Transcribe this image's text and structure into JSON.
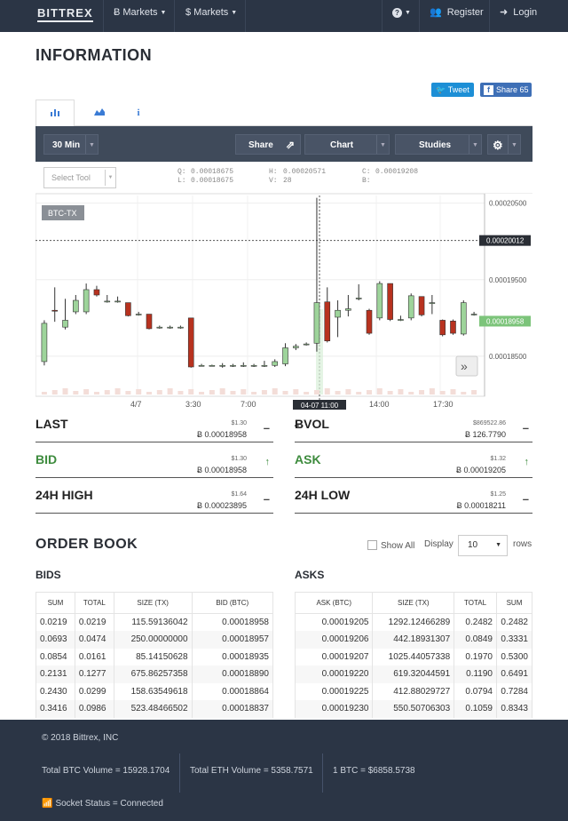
{
  "nav": {
    "brand": "BITTREX",
    "btc_markets": "Ƀ Markets",
    "usd_markets": "$ Markets",
    "help": "?",
    "register": "Register",
    "login": "Login"
  },
  "page_title": "INFORMATION",
  "social": {
    "tweet": "Tweet",
    "share": "Share",
    "share_count": "65"
  },
  "toolbar": {
    "interval": "30 Min",
    "share": "Share",
    "chart": "Chart",
    "studies": "Studies"
  },
  "quote": {
    "select_tool": "Select Tool",
    "o_label": "Q:",
    "o_value": "0.00018675",
    "l_label": "L:",
    "l_value": "0.00018675",
    "h_label": "H:",
    "h_value": "0.00020571",
    "v_label": "V:",
    "v_value": "28",
    "c_label": "C:",
    "c_value": "0.00019208",
    "b_label": "B:"
  },
  "chart_data": {
    "type": "candlestick",
    "symbol": "BTC-TX",
    "x_tick_labels": [
      "4/7",
      "3:30",
      "7:00",
      "04-07 11:00",
      "14:00",
      "17:30"
    ],
    "y_tick_labels": [
      "0.00020500",
      "0.00019500",
      "0.00018500"
    ],
    "ylim": [
      0.00018,
      0.000206
    ],
    "crosshair_price": "0.00020012",
    "last_price": "0.00018958",
    "candles": [
      {
        "o": 0.0001843,
        "c": 0.0001893,
        "h": 0.0001897,
        "l": 0.0001838
      },
      {
        "o": 0.000191,
        "c": 0.0001909,
        "h": 0.000194,
        "l": 0.0001895
      },
      {
        "o": 0.0001888,
        "c": 0.0001897,
        "h": 0.0001925,
        "l": 0.0001885
      },
      {
        "o": 0.0001908,
        "c": 0.0001923,
        "h": 0.000193,
        "l": 0.0001905
      },
      {
        "o": 0.0001908,
        "c": 0.0001937,
        "h": 0.0001945,
        "l": 0.0001905
      },
      {
        "o": 0.0001937,
        "c": 0.000193,
        "h": 0.0001942,
        "l": 0.0001928
      },
      {
        "o": 0.0001922,
        "c": 0.0001922,
        "h": 0.000193,
        "l": 0.000192
      },
      {
        "o": 0.0001922,
        "c": 0.0001922,
        "h": 0.0001928,
        "l": 0.000192
      },
      {
        "o": 0.000192,
        "c": 0.0001903,
        "h": 0.000192,
        "l": 0.0001902
      },
      {
        "o": 0.0001905,
        "c": 0.0001905,
        "h": 0.0001908,
        "l": 0.0001903
      },
      {
        "o": 0.0001905,
        "c": 0.0001886,
        "h": 0.0001905,
        "l": 0.0001885
      },
      {
        "o": 0.0001888,
        "c": 0.0001888,
        "h": 0.000189,
        "l": 0.0001886
      },
      {
        "o": 0.0001888,
        "c": 0.0001888,
        "h": 0.000189,
        "l": 0.0001886
      },
      {
        "o": 0.0001888,
        "c": 0.0001888,
        "h": 0.000189,
        "l": 0.0001886
      },
      {
        "o": 0.00019,
        "c": 0.0001836,
        "h": 0.00019,
        "l": 0.0001835
      },
      {
        "o": 0.0001838,
        "c": 0.0001838,
        "h": 0.000184,
        "l": 0.0001837
      },
      {
        "o": 0.0001838,
        "c": 0.0001838,
        "h": 0.0001839,
        "l": 0.0001837
      },
      {
        "o": 0.0001838,
        "c": 0.0001838,
        "h": 0.0001841,
        "l": 0.0001835
      },
      {
        "o": 0.0001837,
        "c": 0.0001838,
        "h": 0.000184,
        "l": 0.0001836
      },
      {
        "o": 0.0001838,
        "c": 0.0001838,
        "h": 0.0001842,
        "l": 0.0001836
      },
      {
        "o": 0.0001838,
        "c": 0.0001838,
        "h": 0.000184,
        "l": 0.0001836
      },
      {
        "o": 0.0001838,
        "c": 0.0001838,
        "h": 0.0001844,
        "l": 0.0001836
      },
      {
        "o": 0.0001838,
        "c": 0.0001843,
        "h": 0.0001846,
        "l": 0.0001836
      },
      {
        "o": 0.000184,
        "c": 0.0001861,
        "h": 0.0001867,
        "l": 0.0001837
      },
      {
        "o": 0.0001861,
        "c": 0.0001863,
        "h": 0.0001866,
        "l": 0.0001858
      },
      {
        "o": 0.0001865,
        "c": 0.0001866,
        "h": 0.0001868,
        "l": 0.0001864
      },
      {
        "o": 0.0001867,
        "c": 0.000192,
        "h": 0.0002057,
        "l": 0.0001856
      },
      {
        "o": 0.0001921,
        "c": 0.000187,
        "h": 0.000194,
        "l": 0.0001868
      },
      {
        "o": 0.0001901,
        "c": 0.000191,
        "h": 0.0001923,
        "l": 0.0001875
      },
      {
        "o": 0.000191,
        "c": 0.0001912,
        "h": 0.000193,
        "l": 0.0001902
      },
      {
        "o": 0.0001925,
        "c": 0.0001926,
        "h": 0.0001944,
        "l": 0.0001923
      },
      {
        "o": 0.000191,
        "c": 0.000188,
        "h": 0.0001912,
        "l": 0.0001878
      },
      {
        "o": 0.00019,
        "c": 0.0001945,
        "h": 0.0001948,
        "l": 0.0001897
      },
      {
        "o": 0.0001945,
        "c": 0.0001898,
        "h": 0.0001945,
        "l": 0.0001896
      },
      {
        "o": 0.0001898,
        "c": 0.0001898,
        "h": 0.0001903,
        "l": 0.0001896
      },
      {
        "o": 0.00019,
        "c": 0.0001929,
        "h": 0.0001932,
        "l": 0.0001897
      },
      {
        "o": 0.0001928,
        "c": 0.0001904,
        "h": 0.0001928,
        "l": 0.0001902
      },
      {
        "o": 0.000192,
        "c": 0.000192,
        "h": 0.000193,
        "l": 0.0001905
      },
      {
        "o": 0.0001897,
        "c": 0.0001878,
        "h": 0.0001898,
        "l": 0.0001876
      },
      {
        "o": 0.0001896,
        "c": 0.000188,
        "h": 0.0001898,
        "l": 0.0001878
      },
      {
        "o": 0.0001879,
        "c": 0.000192,
        "h": 0.0001923,
        "l": 0.0001877
      },
      {
        "o": 0.0001905,
        "c": 0.0001905,
        "h": 0.0001908,
        "l": 0.0001903
      }
    ]
  },
  "stats": {
    "last": {
      "label": "LAST",
      "usd": "$1.30",
      "btc": "Ƀ 0.00018958",
      "icon": "–"
    },
    "bvol": {
      "label": "ɃVOL",
      "usd": "$869522.86",
      "btc": "Ƀ 126.7790",
      "icon": "–"
    },
    "bid": {
      "label": "BID",
      "usd": "$1.30",
      "btc": "Ƀ 0.00018958",
      "icon": "↑"
    },
    "ask": {
      "label": "ASK",
      "usd": "$1.32",
      "btc": "Ƀ 0.00019205",
      "icon": "↑"
    },
    "high": {
      "label": "24H HIGH",
      "usd": "$1.64",
      "btc": "Ƀ 0.00023895",
      "icon": "–"
    },
    "low": {
      "label": "24H LOW",
      "usd": "$1.25",
      "btc": "Ƀ 0.00018211",
      "icon": "–"
    }
  },
  "orderbook": {
    "title": "ORDER BOOK",
    "show_all": "Show All",
    "display": "Display",
    "display_value": "10",
    "rows_label": "rows",
    "bids_title": "BIDS",
    "asks_title": "ASKS",
    "bid_headers": [
      "SUM",
      "TOTAL",
      "SIZE (TX)",
      "BID (BTC)"
    ],
    "ask_headers": [
      "ASK (BTC)",
      "SIZE (TX)",
      "TOTAL",
      "SUM"
    ],
    "bids": [
      [
        "0.0219",
        "0.0219",
        "115.59136042",
        "0.00018958"
      ],
      [
        "0.0693",
        "0.0474",
        "250.00000000",
        "0.00018957"
      ],
      [
        "0.0854",
        "0.0161",
        "85.14150628",
        "0.00018935"
      ],
      [
        "0.2131",
        "0.1277",
        "675.86257358",
        "0.00018890"
      ],
      [
        "0.2430",
        "0.0299",
        "158.63549618",
        "0.00018864"
      ],
      [
        "0.3416",
        "0.0986",
        "523.48466502",
        "0.00018837"
      ]
    ],
    "asks": [
      [
        "0.00019205",
        "1292.12466289",
        "0.2482",
        "0.2482"
      ],
      [
        "0.00019206",
        "442.18931307",
        "0.0849",
        "0.3331"
      ],
      [
        "0.00019207",
        "1025.44057338",
        "0.1970",
        "0.5300"
      ],
      [
        "0.00019220",
        "619.32044591",
        "0.1190",
        "0.6491"
      ],
      [
        "0.00019225",
        "412.88029727",
        "0.0794",
        "0.7284"
      ],
      [
        "0.00019230",
        "550.50706303",
        "0.1059",
        "0.8343"
      ]
    ]
  },
  "footer": {
    "copyright": "© 2018 Bittrex, INC",
    "btc_volume": "Total BTC Volume = 15928.1704",
    "eth_volume": "Total ETH Volume = 5358.7571",
    "btc_price": "1 BTC = $6858.5738",
    "socket": "Socket Status = Connected"
  },
  "colors": {
    "up": "#9ed49b",
    "down": "#b8321f",
    "nav": "#2b3545"
  }
}
